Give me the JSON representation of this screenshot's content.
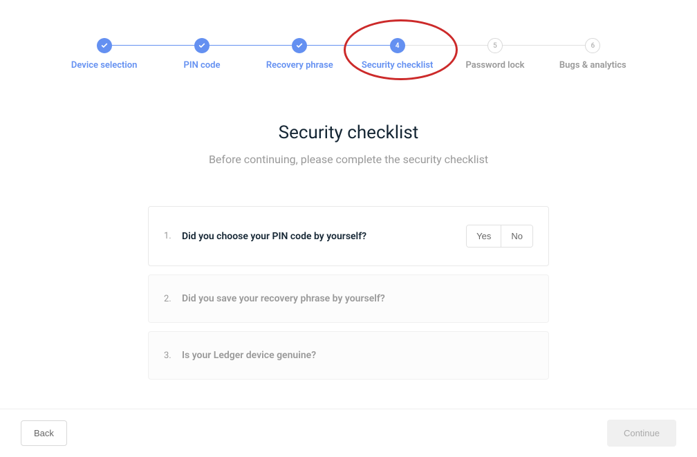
{
  "stepper": {
    "steps": [
      {
        "label": "Device selection",
        "state": "completed"
      },
      {
        "label": "PIN code",
        "state": "completed"
      },
      {
        "label": "Recovery phrase",
        "state": "completed"
      },
      {
        "label": "Security checklist",
        "state": "active",
        "number": "4"
      },
      {
        "label": "Password lock",
        "state": "inactive",
        "number": "5"
      },
      {
        "label": "Bugs & analytics",
        "state": "inactive",
        "number": "6"
      }
    ]
  },
  "main": {
    "title": "Security checklist",
    "subtitle": "Before continuing, please complete the security checklist"
  },
  "checklist": [
    {
      "num": "1.",
      "question": "Did you choose your PIN code by yourself?",
      "enabled": true
    },
    {
      "num": "2.",
      "question": "Did you save your recovery phrase by yourself?",
      "enabled": false
    },
    {
      "num": "3.",
      "question": "Is your Ledger device genuine?",
      "enabled": false
    }
  ],
  "buttons": {
    "yes": "Yes",
    "no": "No",
    "back": "Back",
    "continue": "Continue"
  },
  "colors": {
    "accent": "#6490f1",
    "annotation": "#cc2a2a"
  }
}
